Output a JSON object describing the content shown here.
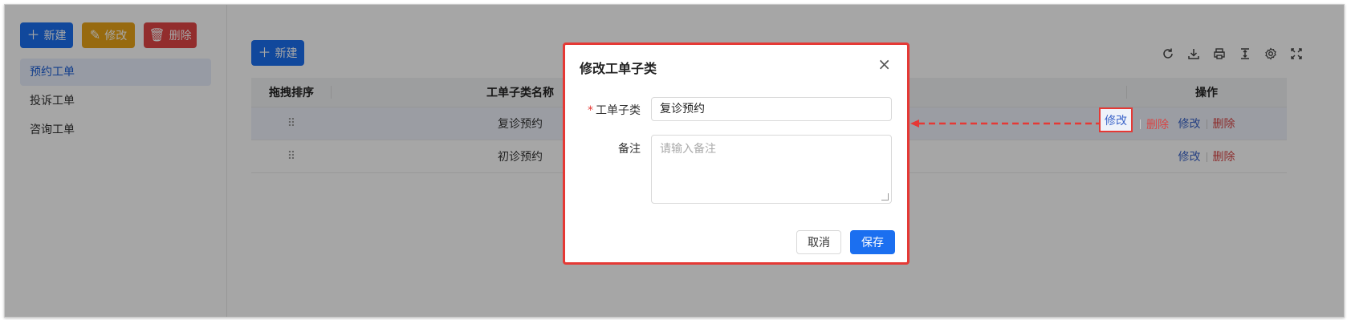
{
  "sidebar": {
    "buttons": {
      "new": "新建",
      "edit": "修改",
      "delete": "删除"
    },
    "items": [
      {
        "label": "预约工单",
        "active": true
      },
      {
        "label": "投诉工单",
        "active": false
      },
      {
        "label": "咨询工单",
        "active": false
      }
    ]
  },
  "main": {
    "new_button": "新建",
    "toolbar_icons": [
      "refresh-icon",
      "download-icon",
      "print-icon",
      "column-height-icon",
      "settings-icon",
      "fullscreen-icon"
    ],
    "table": {
      "headers": {
        "drag": "拖拽排序",
        "name": "工单子类名称",
        "ops": "操作"
      },
      "rows": [
        {
          "drag": "⠿",
          "name": "复诊预约",
          "edit": "修改",
          "delete": "删除"
        },
        {
          "drag": "⠿",
          "name": "初诊预约",
          "edit": "修改",
          "delete": "删除"
        }
      ]
    }
  },
  "modal": {
    "title": "修改工单子类",
    "close": "×",
    "fields": {
      "subtype_label": "工单子类",
      "subtype_value": "复诊预约",
      "remark_label": "备注",
      "remark_placeholder": "请输入备注"
    },
    "cancel": "取消",
    "save": "保存"
  },
  "colors": {
    "primary": "#1b6ff0",
    "warning": "#e8a318",
    "danger": "#e04545",
    "annotation": "#e53935"
  }
}
